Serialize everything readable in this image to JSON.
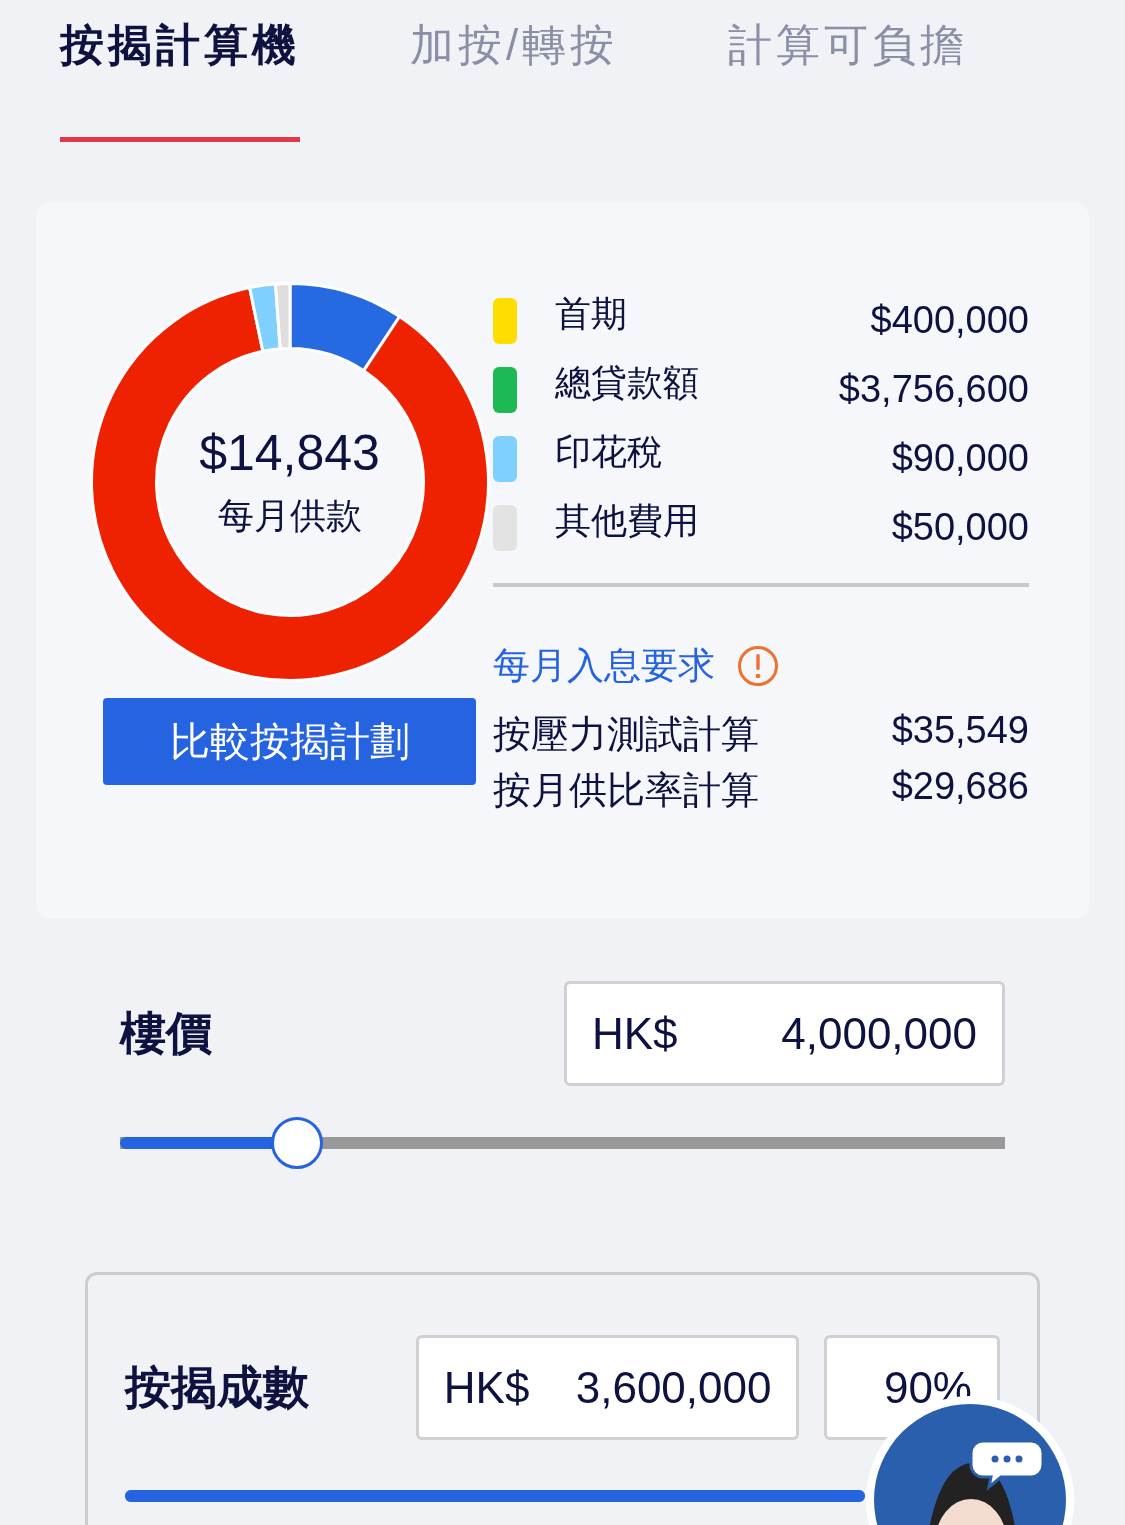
{
  "tabs": [
    {
      "label": "按揭計算機",
      "selected": true
    },
    {
      "label": "加按/轉按",
      "selected": false
    },
    {
      "label": "計算可負擔",
      "selected": false
    }
  ],
  "summary": {
    "monthly_payment": "$14,843",
    "monthly_payment_label": "每月供款",
    "legend": [
      {
        "label": "首期",
        "value": "$400,000",
        "color": "#ffdd00"
      },
      {
        "label": "總貸款額",
        "value": "$3,756,600",
        "color": "#1db954"
      },
      {
        "label": "印花稅",
        "value": "$90,000",
        "color": "#7fcfff"
      },
      {
        "label": "其他費用",
        "value": "$50,000",
        "color": "#e3e3e3"
      }
    ],
    "compare_button": "比較按揭計劃",
    "income_title": "每月入息要求",
    "income_rows": [
      {
        "label": "按壓力測試計算",
        "value": "$35,549"
      },
      {
        "label": "按月供比率計算",
        "value": "$29,686"
      }
    ]
  },
  "price": {
    "label": "樓價",
    "currency": "HK$",
    "value": "4,000,000",
    "level": 0.2
  },
  "ltv": {
    "label": "按揭成數",
    "currency": "HK$",
    "value": "3,600,000",
    "percent": "90%",
    "level": 1
  }
}
